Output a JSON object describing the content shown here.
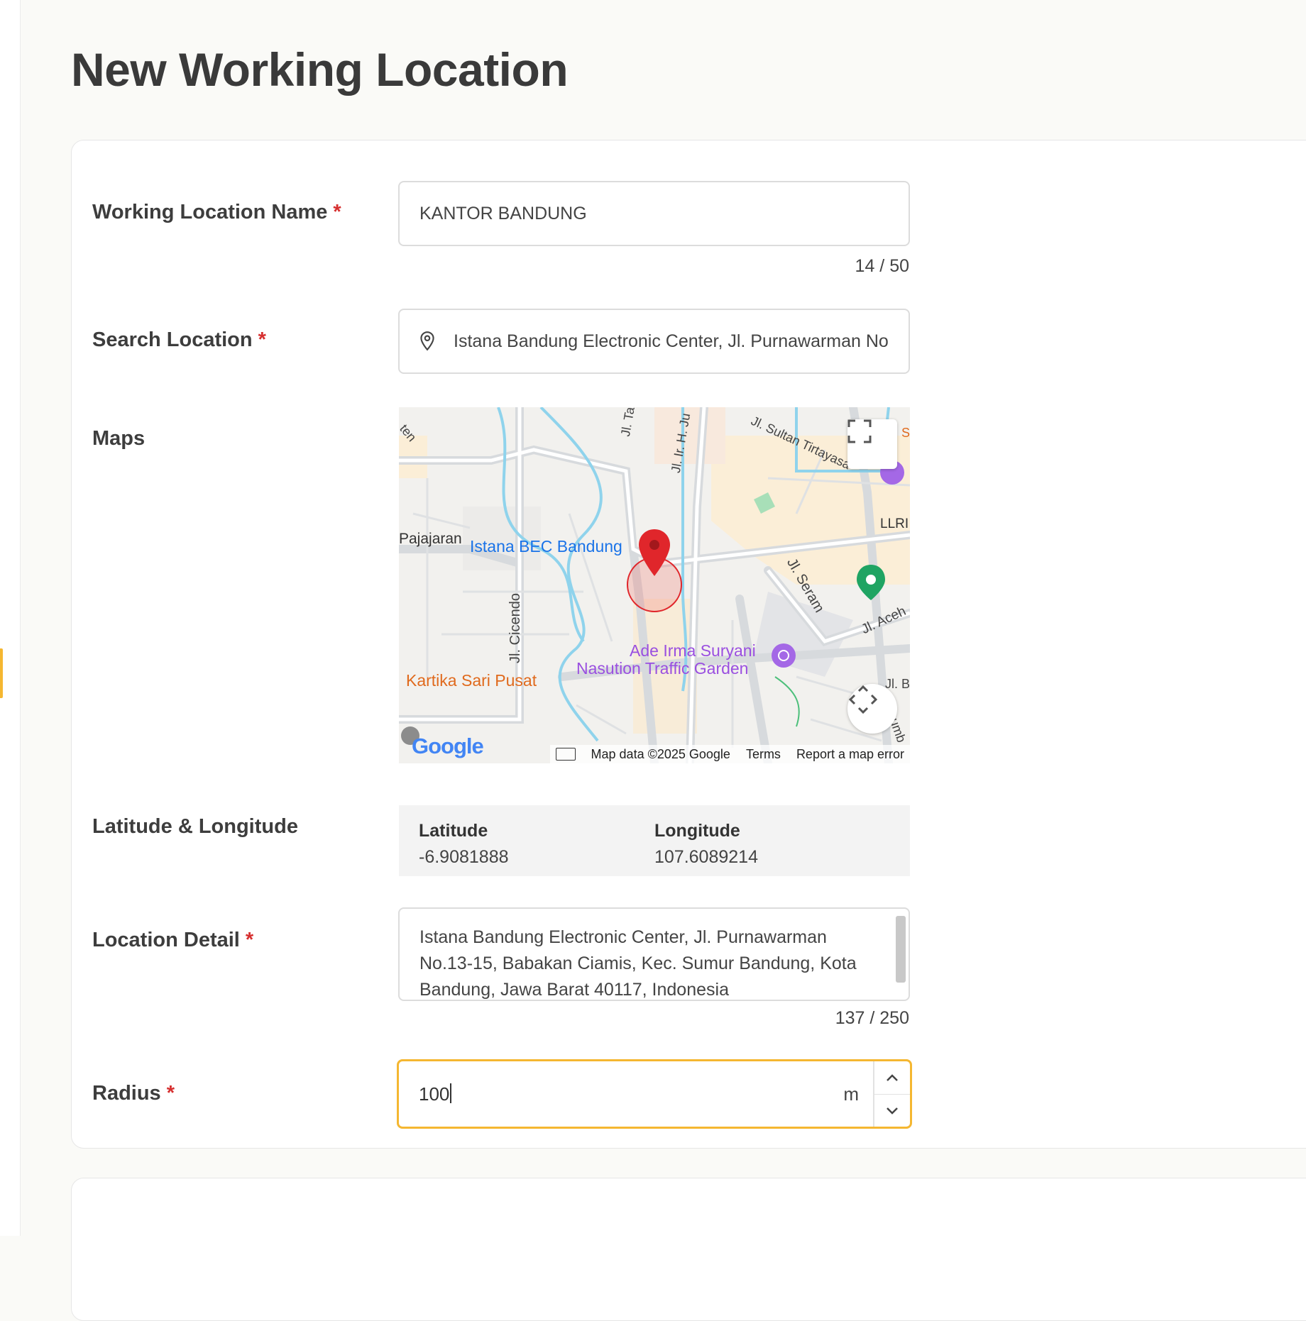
{
  "page": {
    "title": "New Working Location"
  },
  "form": {
    "name": {
      "label": "Working Location Name",
      "required_mark": "*",
      "value": "KANTOR BANDUNG",
      "counter": "14 / 50"
    },
    "search": {
      "label": "Search Location",
      "required_mark": "*",
      "value": "Istana Bandung Electronic Center, Jl. Purnawarman No",
      "icon": "location-pin-icon"
    },
    "maps": {
      "label": "Maps",
      "labels": {
        "bec": "Istana BEC Bandung",
        "pajajaran": "Pajajaran",
        "cicendo": "Jl. Cicendo",
        "seram": "Jl. Seram",
        "aceh": "Jl. Aceh",
        "sultan": "Jl. Sultan Tirtayasa",
        "ir_h": "Jl. Ir. H. Ju",
        "jl_ta": "Jl. Ta",
        "llri": "LLRI",
        "ade_1": "Ade Irma Suryani",
        "ade_2": "Nasution Traffic Garden",
        "kartika": "Kartika Sari Pusat",
        "jl_b": "Jl. B",
        "ten": "ten",
        "s": "S",
        "jmb": "umb"
      },
      "google": "Google",
      "attribution": "Map data ©2025 Google",
      "terms": "Terms",
      "report": "Report a map error"
    },
    "latlng": {
      "label": "Latitude & Longitude",
      "lat_label": "Latitude",
      "lat_value": "-6.9081888",
      "lng_label": "Longitude",
      "lng_value": "107.6089214"
    },
    "detail": {
      "label": "Location Detail",
      "required_mark": "*",
      "value": "Istana Bandung Electronic Center, Jl. Purnawarman No.13-15, Babakan Ciamis, Kec. Sumur Bandung, Kota Bandung, Jawa Barat 40117, Indonesia",
      "counter": "137 / 250"
    },
    "radius": {
      "label": "Radius",
      "required_mark": "*",
      "value": "100",
      "unit": "m"
    }
  },
  "colors": {
    "accent": "#f5b731",
    "required": "#d62f2f",
    "map_pin": "#e0262b"
  }
}
